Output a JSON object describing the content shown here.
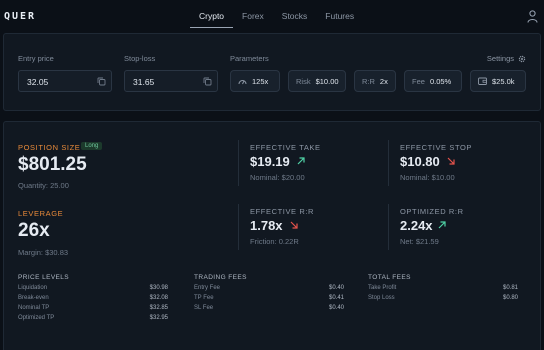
{
  "app": {
    "logo": "QUER"
  },
  "nav": {
    "tabs": [
      "Crypto",
      "Forex",
      "Stocks",
      "Futures"
    ],
    "active": "Crypto"
  },
  "inputs": {
    "entry": {
      "label": "Entry price",
      "value": "32.05"
    },
    "stop": {
      "label": "Stop-loss",
      "value": "31.65"
    }
  },
  "params": {
    "label": "Parameters",
    "settings_label": "Settings",
    "leverage": "125x",
    "risk_key": "Risk",
    "risk_value": "$10.00",
    "rr_key": "R:R",
    "rr_value": "2x",
    "fee_key": "Fee",
    "fee_value": "0.05%",
    "balance": "$25.0k"
  },
  "position": {
    "label": "POSITION SIZE",
    "badge": "Long",
    "value": "$801.25",
    "quantity": "Quantity: 25.00"
  },
  "leverage": {
    "label": "LEVERAGE",
    "value": "26x",
    "margin": "Margin: $30.83"
  },
  "effective_take": {
    "label": "EFFECTIVE TAKE",
    "value": "$19.19",
    "nominal": "Nominal: $20.00",
    "trend": "up"
  },
  "effective_stop": {
    "label": "EFFECTIVE STOP",
    "value": "$10.80",
    "nominal": "Nominal: $10.00",
    "trend": "down"
  },
  "effective_rr": {
    "label": "EFFECTIVE R:R",
    "value": "1.78x",
    "sub": "Friction: 0.22R",
    "trend": "down"
  },
  "optimized_rr": {
    "label": "OPTIMIZED R:R",
    "value": "2.24x",
    "sub": "Net: $21.59",
    "trend": "up"
  },
  "price_levels": {
    "title": "PRICE LEVELS",
    "rows": [
      {
        "k": "Liquidation",
        "v": "$30.98"
      },
      {
        "k": "Break-even",
        "v": "$32.08"
      },
      {
        "k": "Nominal TP",
        "v": "$32.85"
      },
      {
        "k": "Optimized TP",
        "v": "$32.95"
      }
    ]
  },
  "trading_fees": {
    "title": "TRADING FEES",
    "rows": [
      {
        "k": "Entry Fee",
        "v": "$0.40"
      },
      {
        "k": "TP Fee",
        "v": "$0.41"
      },
      {
        "k": "SL Fee",
        "v": "$0.40"
      }
    ]
  },
  "total_fees": {
    "title": "TOTAL FEES",
    "rows": [
      {
        "k": "Take Profit",
        "v": "$0.81"
      },
      {
        "k": "Stop Loss",
        "v": "$0.80"
      }
    ]
  },
  "colors": {
    "accent_orange": "#e88a3a",
    "up": "#4fd1a5",
    "down": "#e5534b",
    "bg": "#0b1017"
  }
}
